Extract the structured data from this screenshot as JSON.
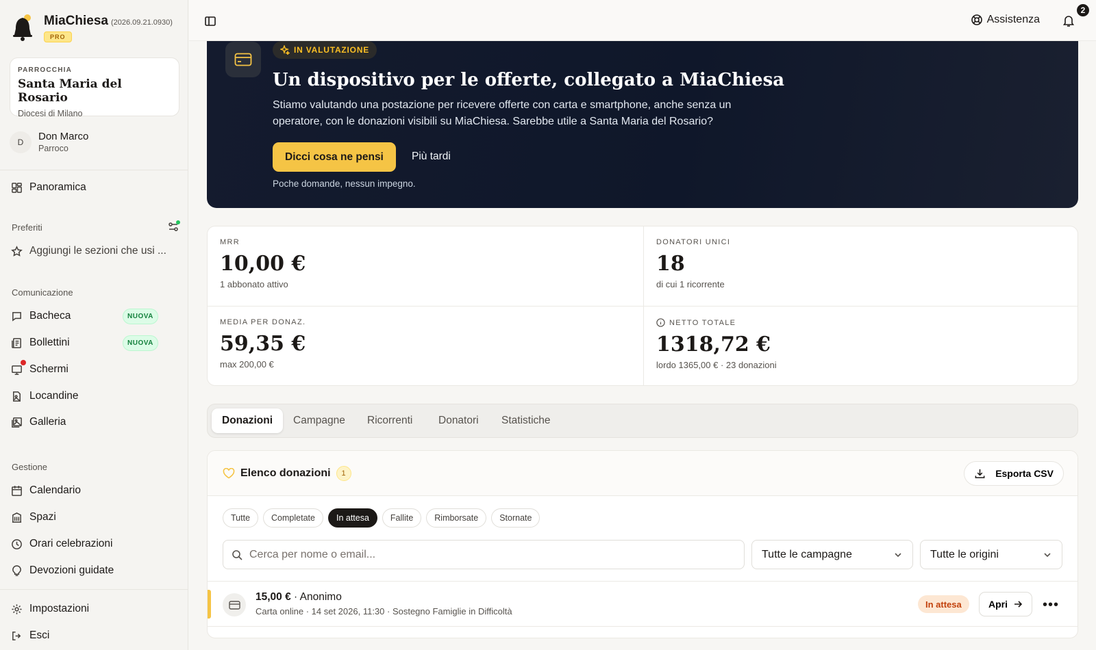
{
  "app": {
    "name": "MiaChiesa",
    "version": "(2026.09.21.0930)",
    "plan": "PRO"
  },
  "parish": {
    "kicker": "PARROCCHIA",
    "name": "Santa Maria del Rosario",
    "diocese": "Diocesi di Milano"
  },
  "user": {
    "initial": "D",
    "name": "Don Marco",
    "role": "Parroco"
  },
  "nav": {
    "overview": "Panoramica",
    "favorites_title": "Preferiti",
    "favorites_add": "Aggiungi le sezioni che usi ...",
    "communication_title": "Comunicazione",
    "communication": [
      {
        "label": "Bacheca",
        "badge": "NUOVA"
      },
      {
        "label": "Bollettini",
        "badge": "NUOVA"
      },
      {
        "label": "Schermi"
      },
      {
        "label": "Locandine"
      },
      {
        "label": "Galleria"
      }
    ],
    "management_title": "Gestione",
    "management": [
      "Calendario",
      "Spazi",
      "Orari celebrazioni",
      "Devozioni guidate"
    ],
    "settings": "Impostazioni",
    "logout": "Esci"
  },
  "topbar": {
    "help": "Assistenza",
    "notifications_count": "2"
  },
  "hero": {
    "pill": "IN VALUTAZIONE",
    "title": "Un dispositivo per le offerte, collegato a MiaChiesa",
    "text": "Stiamo valutando una postazione per ricevere offerte con carta e smartphone, anche senza un operatore, con le donazioni visibili su MiaChiesa. Sarebbe utile a Santa Maria del Rosario?",
    "cta": "Dicci cosa ne pensi",
    "later": "Più tardi",
    "note": "Poche domande, nessun impegno."
  },
  "stats": [
    {
      "key": "MRR",
      "value": "10,00 €",
      "sub": "1 abbonato attivo"
    },
    {
      "key": "DONATORI UNICI",
      "value": "18",
      "sub": "di cui 1 ricorrente"
    },
    {
      "key": "MEDIA PER DONAZ.",
      "value": "59,35 €",
      "sub": "max 200,00 €"
    },
    {
      "key": "NETTO TOTALE",
      "value": "1318,72 €",
      "sub": "lordo 1365,00 € · 23 donazioni"
    }
  ],
  "tabs": [
    "Donazioni",
    "Campagne",
    "Ricorrenti",
    "Donatori",
    "Statistiche"
  ],
  "donations": {
    "title": "Elenco donazioni",
    "count": "1",
    "export": "Esporta CSV",
    "filters": [
      "Tutte",
      "Completate",
      "In attesa",
      "Fallite",
      "Rimborsate",
      "Stornate"
    ],
    "active_filter": "In attesa",
    "search_placeholder": "Cerca per nome o email...",
    "campaign_select": "Tutte le campagne",
    "origin_select": "Tutte le origini",
    "rows": [
      {
        "amount": "15,00 €",
        "sep": "·",
        "donor": "Anonimo",
        "details": "Carta online · 14 set 2026, 11:30 · Sostegno Famiglie in Difficoltà",
        "status": "In attesa",
        "open": "Apri"
      }
    ]
  },
  "colors": {
    "accent": "#f5c445",
    "hero_bg": "#0f172a",
    "new_badge": "#15803d",
    "pending": "#c2410c"
  }
}
